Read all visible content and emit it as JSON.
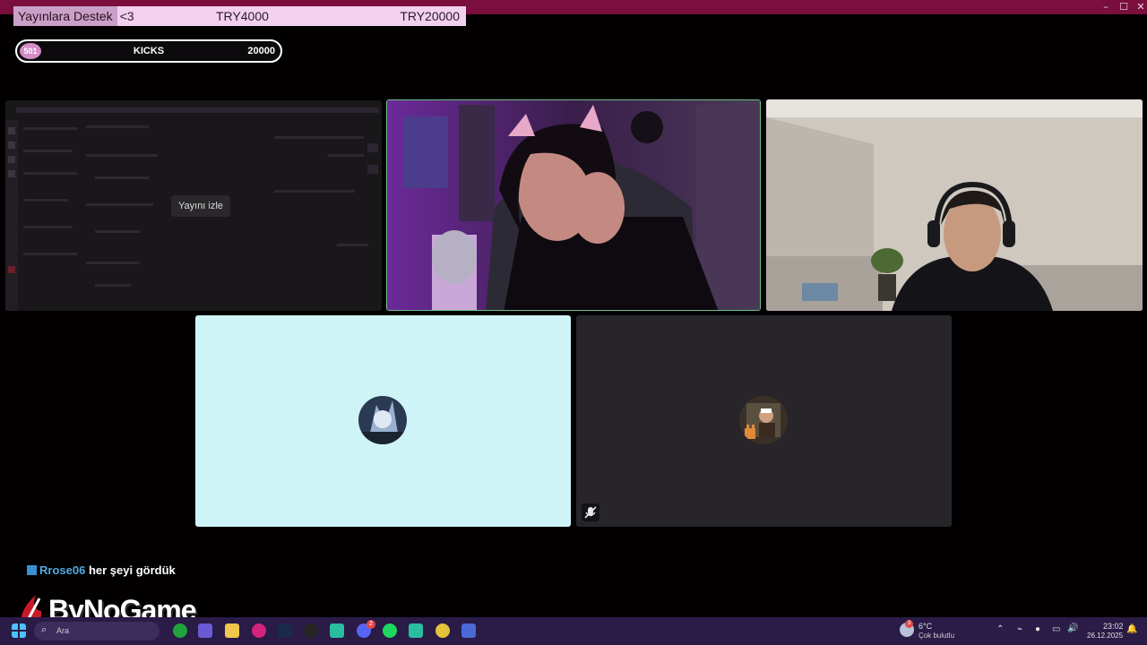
{
  "donation": {
    "label": "Yayınlara Destek",
    "heart": "<3",
    "current": "TRY4000",
    "goal": "TRY20000"
  },
  "kicks": {
    "count": "501",
    "label": "KICKS",
    "target": "20000"
  },
  "tiles": {
    "watch_label": "Yayını izle"
  },
  "chat": {
    "user": "Rrose06",
    "message": "her şeyi gördük"
  },
  "logo": {
    "text": "ByNoGame"
  },
  "taskbar": {
    "search_label": "Ara",
    "discord_badge": "2",
    "weather_badge": "3",
    "weather_temp": "6°C",
    "weather_desc": "Çok bulutlu",
    "time": "23:02",
    "date": "26.12.2025"
  },
  "window_controls": {
    "minimize": "–",
    "maximize": "☐",
    "close": "✕"
  },
  "colors": {
    "titlebar": "#7a0e3c",
    "taskbar": "#2a1b47",
    "speaking_border": "#6fbf86",
    "chat_user": "#52a8e0"
  }
}
